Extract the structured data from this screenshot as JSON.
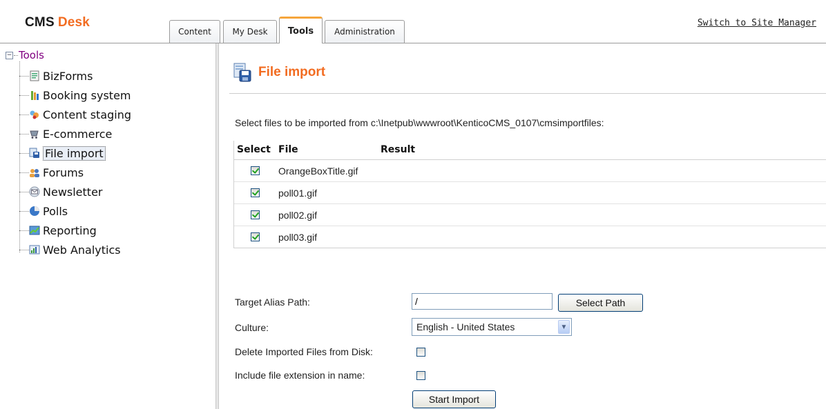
{
  "header": {
    "logo_cms": "CMS",
    "logo_desk": "Desk",
    "tabs": [
      {
        "label": "Content"
      },
      {
        "label": "My Desk"
      },
      {
        "label": "Tools"
      },
      {
        "label": "Administration"
      }
    ],
    "active_tab": "Tools",
    "switch_link": "Switch to Site Manager"
  },
  "tree": {
    "root_label": "Tools",
    "root_expander": "−",
    "items": [
      {
        "label": "BizForms",
        "icon": "bizforms-icon"
      },
      {
        "label": "Booking system",
        "icon": "booking-system-icon"
      },
      {
        "label": "Content staging",
        "icon": "content-staging-icon"
      },
      {
        "label": "E-commerce",
        "icon": "ecommerce-icon"
      },
      {
        "label": "File import",
        "icon": "file-import-icon"
      },
      {
        "label": "Forums",
        "icon": "forums-icon"
      },
      {
        "label": "Newsletter",
        "icon": "newsletter-icon"
      },
      {
        "label": "Polls",
        "icon": "polls-icon"
      },
      {
        "label": "Reporting",
        "icon": "reporting-icon"
      },
      {
        "label": "Web Analytics",
        "icon": "web-analytics-icon"
      }
    ],
    "selected": "File import"
  },
  "main": {
    "title": "File import",
    "instructions": "Select files to be imported from c:\\Inetpub\\wwwroot\\KenticoCMS_0107\\cmsimportfiles:",
    "table": {
      "headers": {
        "select": "Select",
        "file": "File",
        "result": "Result"
      },
      "rows": [
        {
          "file": "OrangeBoxTitle.gif",
          "checked": true,
          "result": ""
        },
        {
          "file": "poll01.gif",
          "checked": true,
          "result": ""
        },
        {
          "file": "poll02.gif",
          "checked": true,
          "result": ""
        },
        {
          "file": "poll03.gif",
          "checked": true,
          "result": ""
        }
      ]
    },
    "form": {
      "target_alias_label": "Target Alias Path:",
      "target_alias_value": "/",
      "select_path_button": "Select Path",
      "culture_label": "Culture:",
      "culture_value": "English - United States",
      "delete_files_label": "Delete Imported Files from Disk:",
      "delete_files_checked": false,
      "include_ext_label": "Include file extension in name:",
      "include_ext_checked": false,
      "start_import_button": "Start Import"
    }
  },
  "colors": {
    "accent": "#f26c21",
    "tab_highlight": "#f6a53b",
    "tree_root": "#800080",
    "check": "#21a121"
  }
}
